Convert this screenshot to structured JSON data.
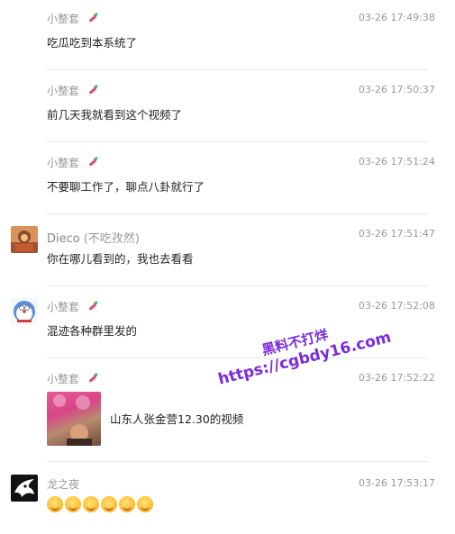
{
  "messages": [
    {
      "name": "小整套",
      "suffix": "",
      "time": "03-26 17:49:38",
      "text": "吃瓜吃到本系统了"
    },
    {
      "name": "小整套",
      "suffix": "",
      "time": "03-26 17:50:37",
      "text": "前几天我就看到这个视频了"
    },
    {
      "name": "小整套",
      "suffix": "",
      "time": "03-26 17:51:24",
      "text": "不要聊工作了，聊点八卦就行了"
    },
    {
      "name": "Dieco",
      "suffix": "(不吃孜然)",
      "time": "03-26 17:51:47",
      "text": "你在哪儿看到的，我也去看看"
    },
    {
      "name": "小整套",
      "suffix": "",
      "time": "03-26 17:52:08",
      "text": "混迹各种群里发的"
    },
    {
      "name": "小整套",
      "suffix": "",
      "time": "03-26 17:52:22",
      "card_title": "山东人张金营12.30的视频"
    },
    {
      "name": "龙之夜",
      "suffix": "",
      "time": "03-26 17:53:17",
      "emoji_count": 6
    }
  ],
  "watermark": {
    "line1": "黑料不打烊",
    "line2": "https://cgbdy16.com"
  },
  "colors": {
    "meta": "#999999",
    "text": "#222222",
    "divider": "#e8e8e8",
    "watermark": "#7b2bd9"
  }
}
